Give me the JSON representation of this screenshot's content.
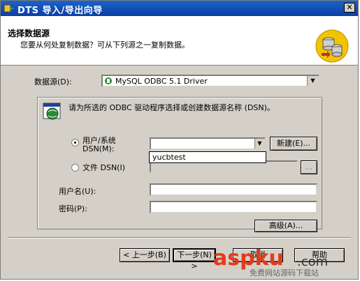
{
  "window": {
    "title": "DTS 导入/导出向导",
    "close_label": "✕"
  },
  "header": {
    "title": "选择数据源",
    "subtitle": "您要从何处复制数据？可从下列源之一复制数据。"
  },
  "data_source": {
    "label": "数据源(D):",
    "value": "MySQL ODBC 5.1 Driver"
  },
  "group": {
    "description": "请为所选的 ODBC 驱动程序选择或创建数据源名称 (DSN)。",
    "user_system_dsn_label": "用户/系统",
    "user_system_dsn_label2": "DSN(M):",
    "user_system_selected": true,
    "dsn_dropdown_option": "yucbtest",
    "new_button": "新建(E)...",
    "file_dsn_label": "文件 DSN(I)",
    "browse_button": "...",
    "username_label": "用户名(U):",
    "password_label": "密码(P):",
    "advanced_button": "高级(A)..."
  },
  "footer": {
    "back_button": "< 上一步(B)",
    "next_button": "下一步(N) >",
    "cancel_button": "取消",
    "help_button": "帮助"
  },
  "watermark": {
    "brand": "aspku",
    "suffix": ".com",
    "tagline": "免费网站源码下载站"
  }
}
